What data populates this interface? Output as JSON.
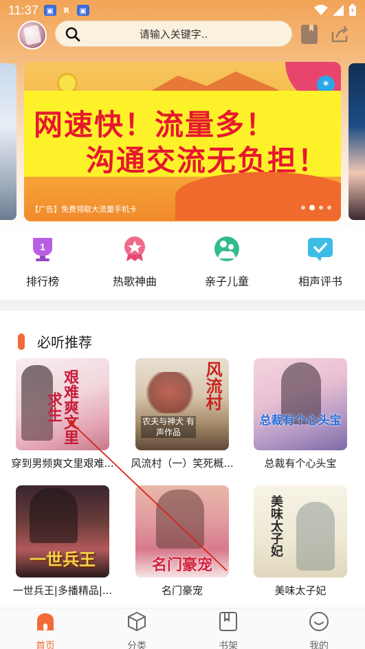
{
  "status_bar": {
    "time": "11:37"
  },
  "search": {
    "placeholder": "请输入关键字.."
  },
  "banner": {
    "line1": "网速快！流量多！",
    "line2": "沟通交流无负担！",
    "ad_text": "【广告】免费领取大流量手机卡",
    "page_count": 4,
    "active_index": 1
  },
  "categories": [
    {
      "label": "排行榜",
      "icon": "trophy-icon"
    },
    {
      "label": "热歌神曲",
      "icon": "star-badge-icon"
    },
    {
      "label": "亲子儿童",
      "icon": "parent-child-icon"
    },
    {
      "label": "相声评书",
      "icon": "chat-check-icon"
    }
  ],
  "section": {
    "title": "必听推荐"
  },
  "books": [
    {
      "title": "穿到男频爽文里艰难...",
      "cover_text": "艰难爽文里求生"
    },
    {
      "title": "风流村（一）笑死概...",
      "cover_text": "风流村",
      "cover_sub": "农夫与神犬 有声作品"
    },
    {
      "title": "总裁有个心头宝",
      "cover_text": "总裁有个心头宝"
    },
    {
      "title": "一世兵王|多播精品|...",
      "cover_text": "一世兵王"
    },
    {
      "title": "名门豪宠",
      "cover_text": "名门豪宠"
    },
    {
      "title": "美味太子妃",
      "cover_text": "美味太子妃"
    }
  ],
  "tabs": [
    {
      "label": "首页",
      "icon": "home-icon",
      "active": true
    },
    {
      "label": "分类",
      "icon": "cube-icon",
      "active": false
    },
    {
      "label": "书架",
      "icon": "bookshelf-icon",
      "active": false
    },
    {
      "label": "我的",
      "icon": "smile-icon",
      "active": false
    }
  ],
  "colors": {
    "accent": "#f26a3a",
    "banner_text": "#e5182e",
    "banner_yellow": "#fdf22a"
  }
}
